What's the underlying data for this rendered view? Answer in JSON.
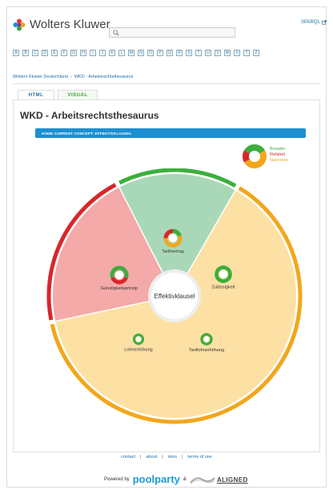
{
  "header": {
    "brand": "Wolters Kluwer",
    "sparql_label": "SPARQL",
    "search_placeholder": ""
  },
  "alphabet": [
    "A",
    "B",
    "C",
    "D",
    "E",
    "F",
    "G",
    "H",
    "I",
    "J",
    "K",
    "L",
    "M",
    "N",
    "O",
    "P",
    "Q",
    "R",
    "S",
    "T",
    "U",
    "V",
    "W",
    "X",
    "Y",
    "Z"
  ],
  "breadcrumb": {
    "root": "Wolters Kluwer Deutschland",
    "separator": "›",
    "current": "WKD - Arbeitsrechtsthesaurus"
  },
  "tabs": {
    "html": "HTML",
    "visual": "VISUAL"
  },
  "page_title": "WKD - Arbeitsrechtsthesaurus",
  "home_concept": "HOME CURRENT CONCEPT: EFFEKTIVKLAUSEL",
  "legend": {
    "broader": "Broader",
    "related": "Related",
    "narrower": "Narrower",
    "colors": {
      "broader": "#3cae3c",
      "related": "#d9262b",
      "narrower": "#f2a71b"
    }
  },
  "wheel": {
    "center": "Effektivklausel",
    "nodes": {
      "tarifvertrag": "Tarifvertrag",
      "guenstigkeitsprinzip": "Günstigkeitsprinzip",
      "zulaessigkeit": "Zulässigkeit",
      "lohnerhoehung": "Lohnerhöhung",
      "tariflohnerhoehung": "Tariflohnerhöhung"
    },
    "colors": {
      "broader_fill": "#a9d8b8",
      "related_fill": "#f4aaa8",
      "narrower_fill": "#fde0a4"
    }
  },
  "footer": {
    "contact": "contact",
    "about": "about",
    "skos": "skos",
    "terms": "terms of use",
    "pipe": "|",
    "powered_by": "Powered by",
    "poolparty_a": "pool",
    "poolparty_b": "party",
    "amp": "&",
    "aligned": "ALIGNED"
  }
}
